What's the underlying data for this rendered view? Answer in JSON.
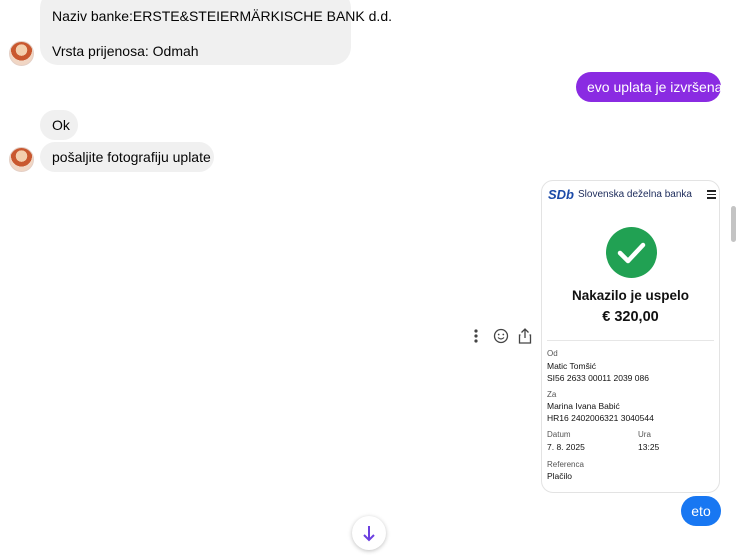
{
  "messages": {
    "bank_details": {
      "line1": "Naziv banke:ERSTE&STEIERMÄRKISCHE BANK d.d.",
      "line2": "Vrsta prijenosa: Odmah"
    },
    "sent_confirmation": "evo uplata je izvršena",
    "ok": "Ok",
    "request_photo": "pošaljite fotografiju uplate",
    "sent_eto": "eto"
  },
  "receipt": {
    "bank_logo": "SDb",
    "bank_name": "Slovenska deželna banka",
    "status": "Nakazilo je uspelo",
    "amount": "€ 320,00",
    "from_label": "Od",
    "from_name": "Matic Tomšić",
    "from_iban": "SI56 2633 00011 2039 086",
    "to_label": "Za",
    "to_name": "Marina Ivana Babić",
    "to_iban": "HR16 2402006321 3040544",
    "date_label": "Datum",
    "date_value": "7. 8. 2025",
    "time_label": "Ura",
    "time_value": "13:25",
    "reference_label": "Referenca",
    "reference_value": "Plačilo"
  },
  "colors": {
    "outgoing_purple": "#8a2be2",
    "outgoing_blue": "#1877f2",
    "incoming_bg": "#f0f0f0",
    "success_green": "#21a153",
    "bank_blue": "#1b4aa8"
  },
  "icons": [
    "more-options-icon",
    "emoji-reaction-icon",
    "share-icon",
    "hamburger-menu-icon",
    "checkmark-icon",
    "scroll-down-icon"
  ]
}
